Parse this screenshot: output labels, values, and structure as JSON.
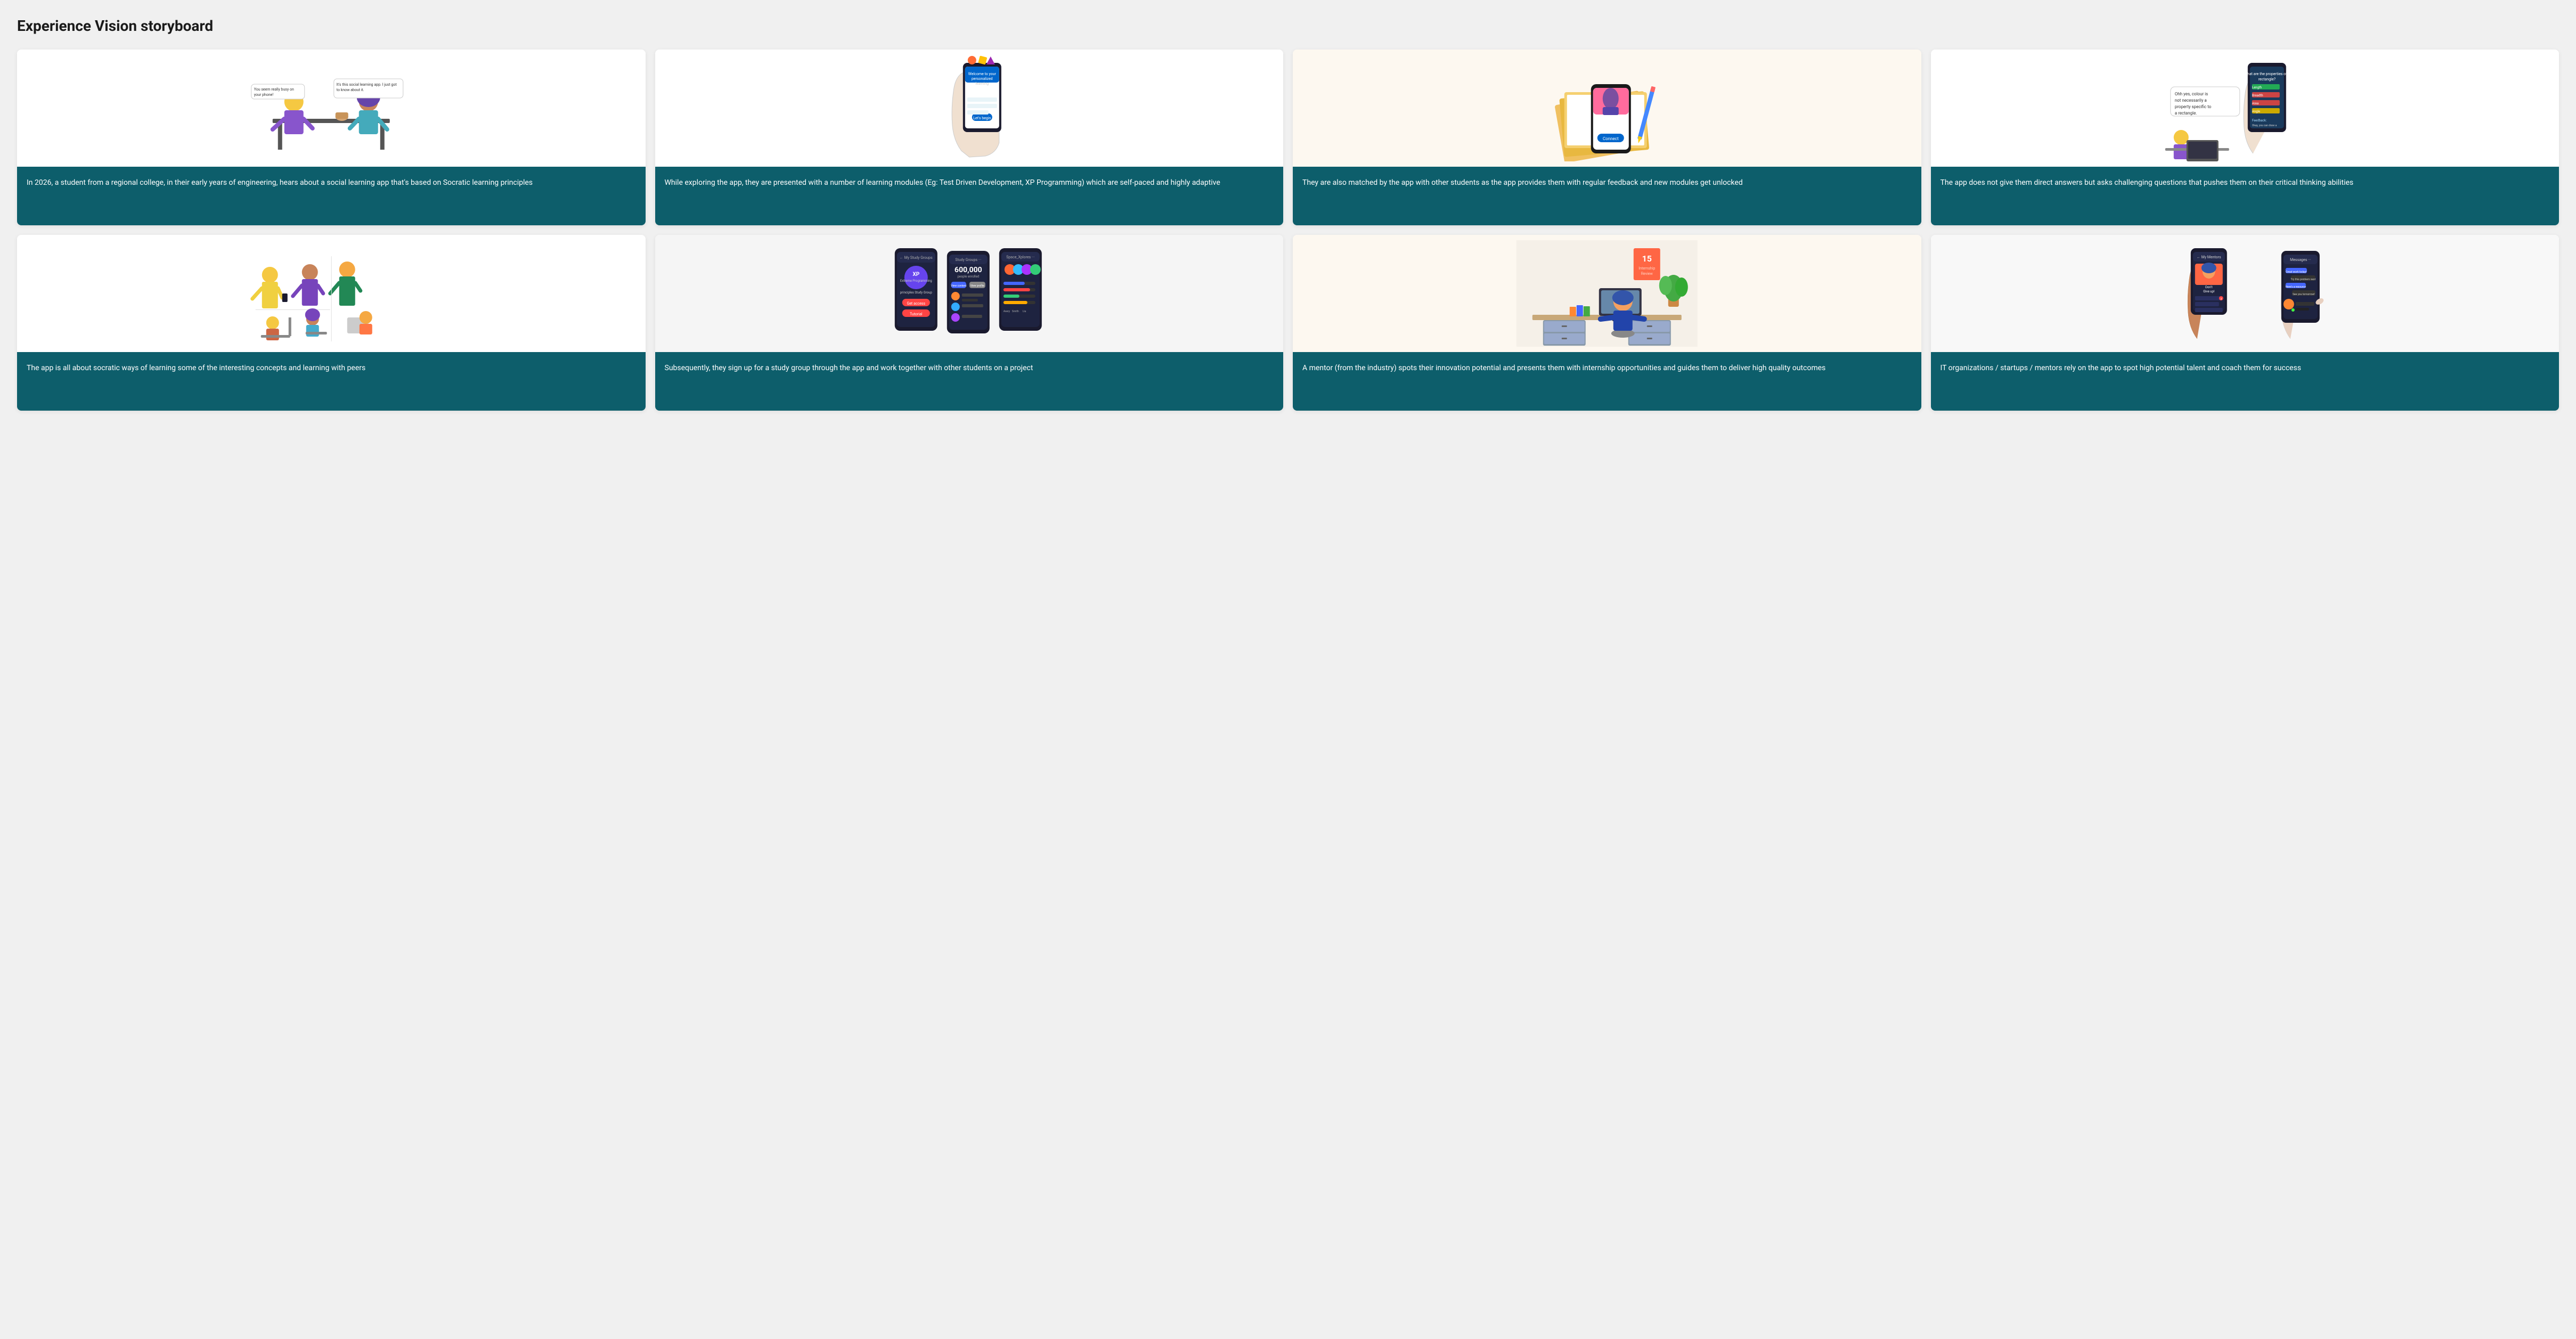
{
  "page": {
    "title": "Experience Vision storyboard"
  },
  "cards": [
    {
      "id": "card-1",
      "text": "In 2026, a student from a regional college, in their early years of engineering, hears about a social learning app that's based on Socratic learning principles",
      "alt": "Two women sitting at a table, one showing phone to another, speech bubbles",
      "row": 1
    },
    {
      "id": "card-2",
      "text": "While exploring the app, they are presented with a number of learning modules (Eg: Test Driven Development, XP Programming) which are self-paced and highly adaptive",
      "alt": "Hand holding a smartphone with colorful app interface",
      "row": 1
    },
    {
      "id": "card-3",
      "text": "They are also matched by the app with other students as the app provides them with regular feedback and new modules get unlocked",
      "alt": "Smartphone with connect screen next to notebook and pencil",
      "row": 1
    },
    {
      "id": "card-4",
      "text": "The app does not give them direct answers but asks challenging questions that pushes them on their critical thinking abilities",
      "alt": "Hand holding phone showing quiz, person sitting at desk",
      "row": 1
    },
    {
      "id": "card-5",
      "text": "The app is all about socratic ways of learning some of the interesting concepts and learning with peers",
      "alt": "Group of diverse students standing and sitting",
      "row": 2
    },
    {
      "id": "card-6",
      "text": "Subsequently, they sign up for a study group through the app and work together with other students on a project",
      "alt": "Study groups app screens showing XP programming study group",
      "row": 2
    },
    {
      "id": "card-7",
      "text": "A mentor (from the industry) spots their innovation potential and presents them with internship opportunities and guides them to deliver high quality outcomes",
      "alt": "Mentor sitting at desk with computer and documents",
      "row": 2
    },
    {
      "id": "card-8",
      "text": "IT organizations / startups / mentors rely on the app to spot high potential talent and coach them for success",
      "alt": "Hands holding phones showing My Mentors app screen",
      "row": 2
    }
  ],
  "colors": {
    "cardTextBg": "#0d5e6b",
    "cardTextColor": "#ffffff",
    "pageBg": "#f0f0f0",
    "titleColor": "#1a1a1a"
  }
}
